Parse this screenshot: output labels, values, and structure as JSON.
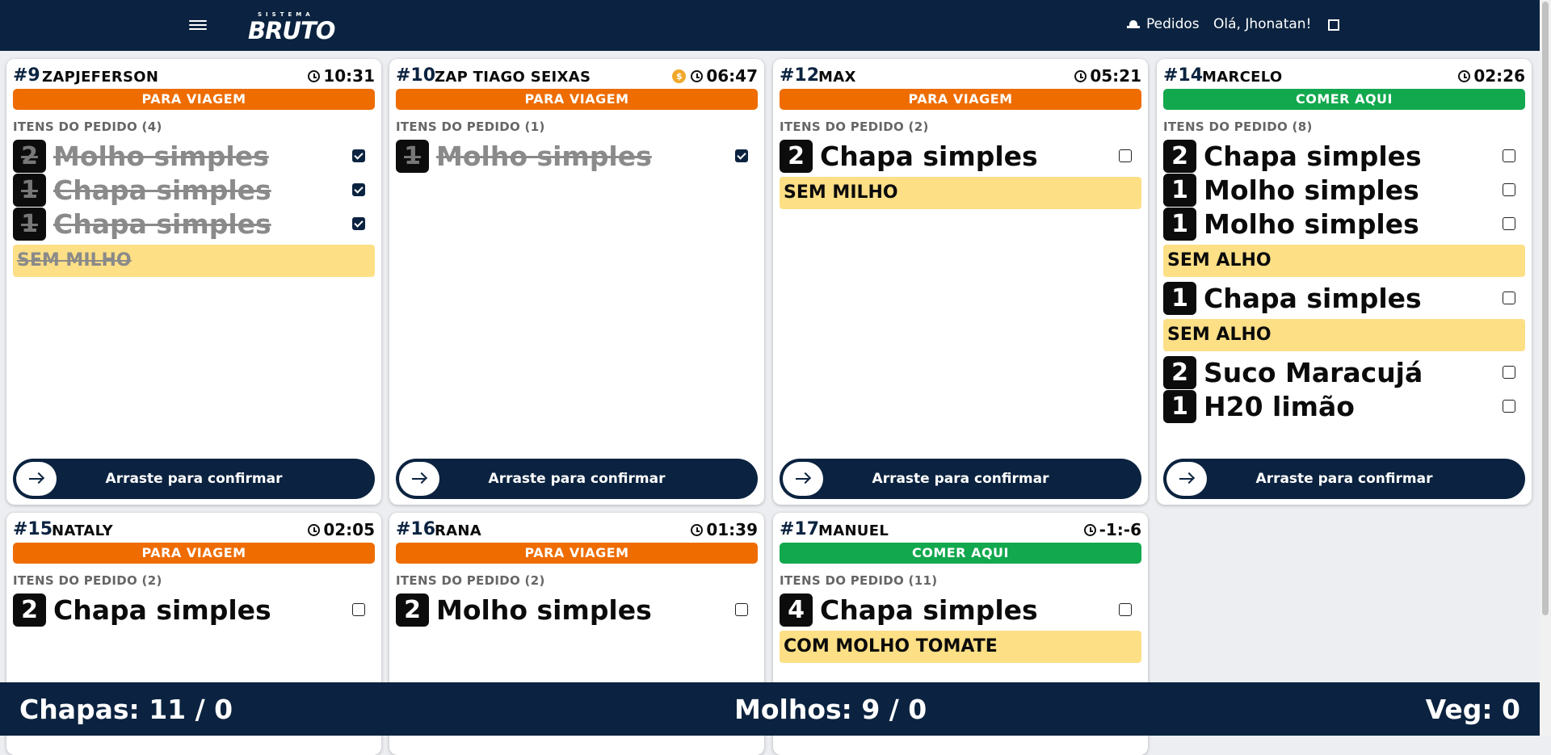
{
  "header": {
    "logo_subtitle": "SISTEMA",
    "logo_title": "BRUTO",
    "nav_pedidos": "Pedidos",
    "greeting": "Olá, Jhonatan!"
  },
  "orders": [
    {
      "number": "#9",
      "customer": "ZAPJEFERSON",
      "time": "10:31",
      "paid_icon": false,
      "type": "PARA VIAGEM",
      "type_color": "#ee6c00",
      "items_title": "ITENS DO PEDIDO (4)",
      "items": [
        {
          "qty": "2",
          "name": "Molho simples",
          "done": true
        },
        {
          "qty": "1",
          "name": "Chapa simples",
          "done": true
        },
        {
          "qty": "1",
          "name": "Chapa simples",
          "done": true,
          "note": "SEM MILHO"
        }
      ],
      "confirm_label": "Arraste para confirmar"
    },
    {
      "number": "#10",
      "customer": "ZAP TIAGO SEIXAS",
      "time": "06:47",
      "paid_icon": true,
      "paid_symbol": "$",
      "type": "PARA VIAGEM",
      "type_color": "#ee6c00",
      "items_title": "ITENS DO PEDIDO (1)",
      "items": [
        {
          "qty": "1",
          "name": "Molho simples",
          "done": true
        }
      ],
      "confirm_label": "Arraste para confirmar"
    },
    {
      "number": "#12",
      "customer": "MAX",
      "time": "05:21",
      "paid_icon": false,
      "type": "PARA VIAGEM",
      "type_color": "#ee6c00",
      "items_title": "ITENS DO PEDIDO (2)",
      "items": [
        {
          "qty": "2",
          "name": "Chapa simples",
          "done": false,
          "note": "SEM MILHO"
        }
      ],
      "confirm_label": "Arraste para confirmar"
    },
    {
      "number": "#14",
      "customer": "MARCELO",
      "time": "02:26",
      "paid_icon": false,
      "type": "COMER AQUI",
      "type_color": "#12a84e",
      "items_title": "ITENS DO PEDIDO (8)",
      "items": [
        {
          "qty": "2",
          "name": "Chapa simples",
          "done": false
        },
        {
          "qty": "1",
          "name": "Molho simples",
          "done": false
        },
        {
          "qty": "1",
          "name": "Molho simples",
          "done": false,
          "note": "SEM ALHO"
        },
        {
          "qty": "1",
          "name": "Chapa simples",
          "done": false,
          "note": "SEM ALHO"
        },
        {
          "qty": "2",
          "name": "Suco Maracujá",
          "done": false
        },
        {
          "qty": "1",
          "name": "H20 limão",
          "done": false
        }
      ],
      "confirm_label": "Arraste para confirmar"
    },
    {
      "number": "#15",
      "customer": "NATALY",
      "time": "02:05",
      "paid_icon": false,
      "type": "PARA VIAGEM",
      "type_color": "#ee6c00",
      "items_title": "ITENS DO PEDIDO (2)",
      "items": [
        {
          "qty": "2",
          "name": "Chapa simples",
          "done": false
        }
      ]
    },
    {
      "number": "#16",
      "customer": "RANA",
      "time": "01:39",
      "paid_icon": false,
      "type": "PARA VIAGEM",
      "type_color": "#ee6c00",
      "items_title": "ITENS DO PEDIDO (2)",
      "items": [
        {
          "qty": "2",
          "name": "Molho simples",
          "done": false
        }
      ]
    },
    {
      "number": "#17",
      "customer": "MANUEL",
      "time": "-1:-6",
      "paid_icon": false,
      "type": "COMER AQUI",
      "type_color": "#12a84e",
      "items_title": "ITENS DO PEDIDO (11)",
      "items": [
        {
          "qty": "4",
          "name": "Chapa simples",
          "done": false,
          "note": "COM MOLHO TOMATE"
        }
      ]
    }
  ],
  "stats": {
    "chapas": "Chapas: 11 / 0",
    "molhos": "Molhos: 9 / 0",
    "veg": "Veg: 0"
  }
}
